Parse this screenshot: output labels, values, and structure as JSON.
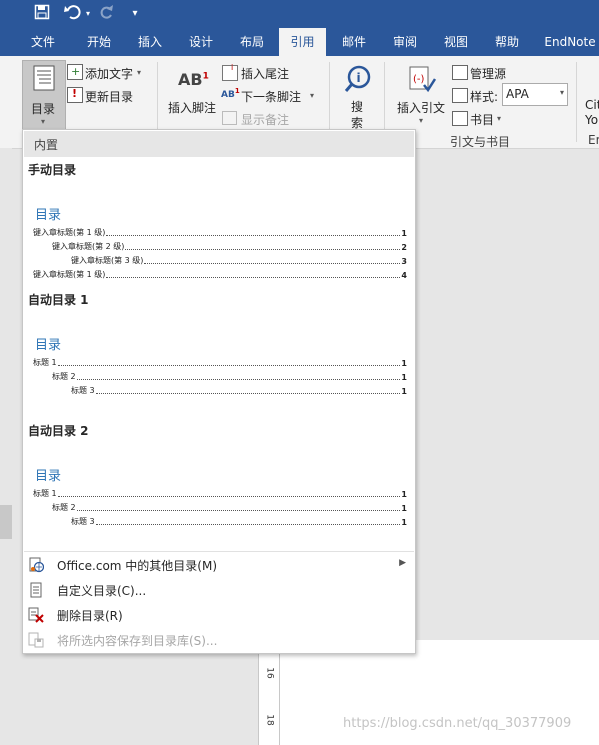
{
  "quick_access": {
    "save_icon": "save-icon",
    "undo_icon": "undo-icon",
    "redo_icon": "redo-icon",
    "customize_icon": "customize-qat-icon"
  },
  "tabs": {
    "file": "文件",
    "home": "开始",
    "insert": "插入",
    "design": "设计",
    "layout": "布局",
    "references": "引用",
    "mailings": "邮件",
    "review": "审阅",
    "view": "视图",
    "help": "帮助",
    "endnote": "EndNote"
  },
  "ribbon": {
    "toc_button": "目录",
    "add_text": "添加文字",
    "update_toc": "更新目录",
    "insert_footnote": "插入脚注",
    "insert_endnote": "插入尾注",
    "next_footnote": "下一条脚注",
    "show_notes": "显示备注",
    "search": "搜\n索",
    "search_line1": "搜",
    "search_line2": "索",
    "insert_citation": "插入引文",
    "manage_sources": "管理源",
    "style_label": "样式:",
    "style_value": "APA",
    "bibliography": "书目",
    "group_citations": "引文与书目",
    "cut_off_1": "Cit",
    "cut_off_2": "Yo",
    "cut_off_3": "Er"
  },
  "dropdown": {
    "section_builtin": "内置",
    "manual": {
      "title": "手动目录",
      "heading": "目录",
      "lines": [
        {
          "label": "键入章标题(第 1 级)",
          "page": "1"
        },
        {
          "label": "键入章标题(第 2 级)",
          "page": "2"
        },
        {
          "label": "键入章标题(第 3 级)",
          "page": "3"
        },
        {
          "label": "键入章标题(第 1 级)",
          "page": "4"
        }
      ]
    },
    "auto1": {
      "title": "自动目录 1",
      "heading": "目录",
      "lines": [
        {
          "label": "标题 1",
          "page": "1"
        },
        {
          "label": "标题 2",
          "page": "1"
        },
        {
          "label": "标题 3",
          "page": "1"
        }
      ]
    },
    "auto2": {
      "title": "自动目录 2",
      "heading": "目录",
      "lines": [
        {
          "label": "标题 1",
          "page": "1"
        },
        {
          "label": "标题 2",
          "page": "1"
        },
        {
          "label": "标题 3",
          "page": "1"
        }
      ]
    },
    "menu": {
      "office_more": "Office.com 中的其他目录(M)",
      "custom": "自定义目录(C)...",
      "remove": "删除目录(R)",
      "save_selection": "将所选内容保存到目录库(S)..."
    }
  },
  "ruler": {
    "mark16": "16",
    "mark18": "18"
  },
  "watermark": "https://blog.csdn.net/qq_30377909"
}
